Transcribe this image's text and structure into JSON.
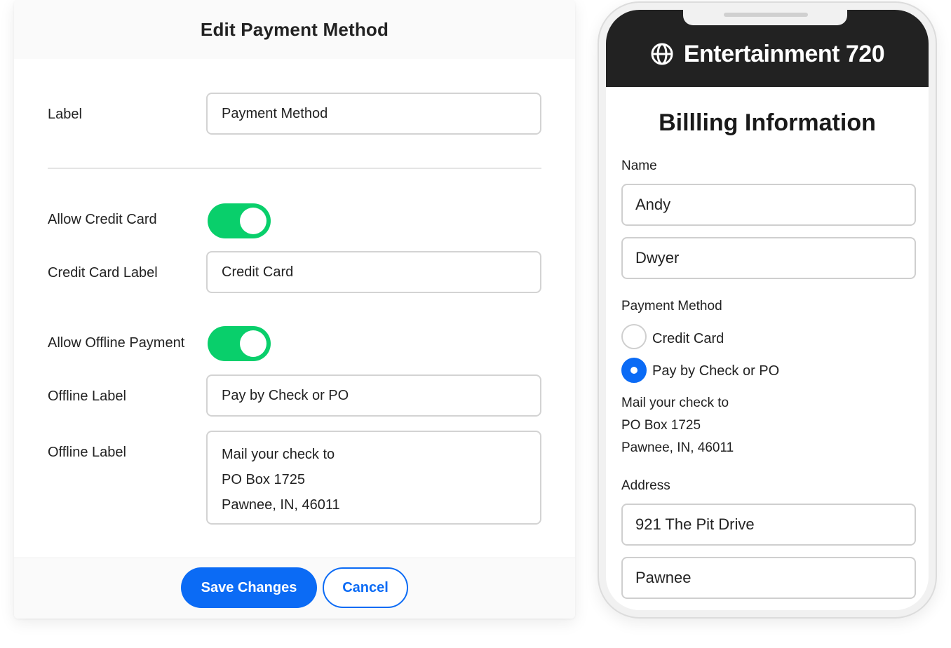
{
  "edit_panel": {
    "title": "Edit Payment Method",
    "label_label": "Label",
    "label_value": "Payment Method",
    "allow_credit_card_label": "Allow Credit Card",
    "allow_credit_card_on": true,
    "credit_card_label_label": "Credit Card Label",
    "credit_card_label_value": "Credit Card",
    "allow_offline_label": "Allow Offline Payment",
    "allow_offline_on": true,
    "offline_label_label": "Offline Label",
    "offline_label_value": "Pay by Check or PO",
    "offline_instructions_label": "Offline Label",
    "offline_instructions_lines": [
      "Mail your check to",
      "PO Box 1725",
      "Pawnee, IN, 46011"
    ],
    "save_button": "Save Changes",
    "cancel_button": "Cancel"
  },
  "phone": {
    "brand_icon": "globe-icon",
    "brand_name": "Entertainment 720",
    "title": "Billling Information",
    "name_label": "Name",
    "first_name": "Andy",
    "last_name": "Dwyer",
    "payment_method_label": "Payment Method",
    "payment_options": [
      {
        "label": "Credit Card",
        "selected": false
      },
      {
        "label": "Pay by Check or PO",
        "selected": true
      }
    ],
    "mail_lines": [
      "Mail your check to",
      "PO Box 1725",
      "Pawnee, IN, 46011"
    ],
    "address_label": "Address",
    "address_line1": "921 The Pit Drive",
    "city": "Pawnee"
  },
  "colors": {
    "accent": "#0b6bf5",
    "toggle_on": "#09cf6b",
    "header_dark": "#222222"
  }
}
